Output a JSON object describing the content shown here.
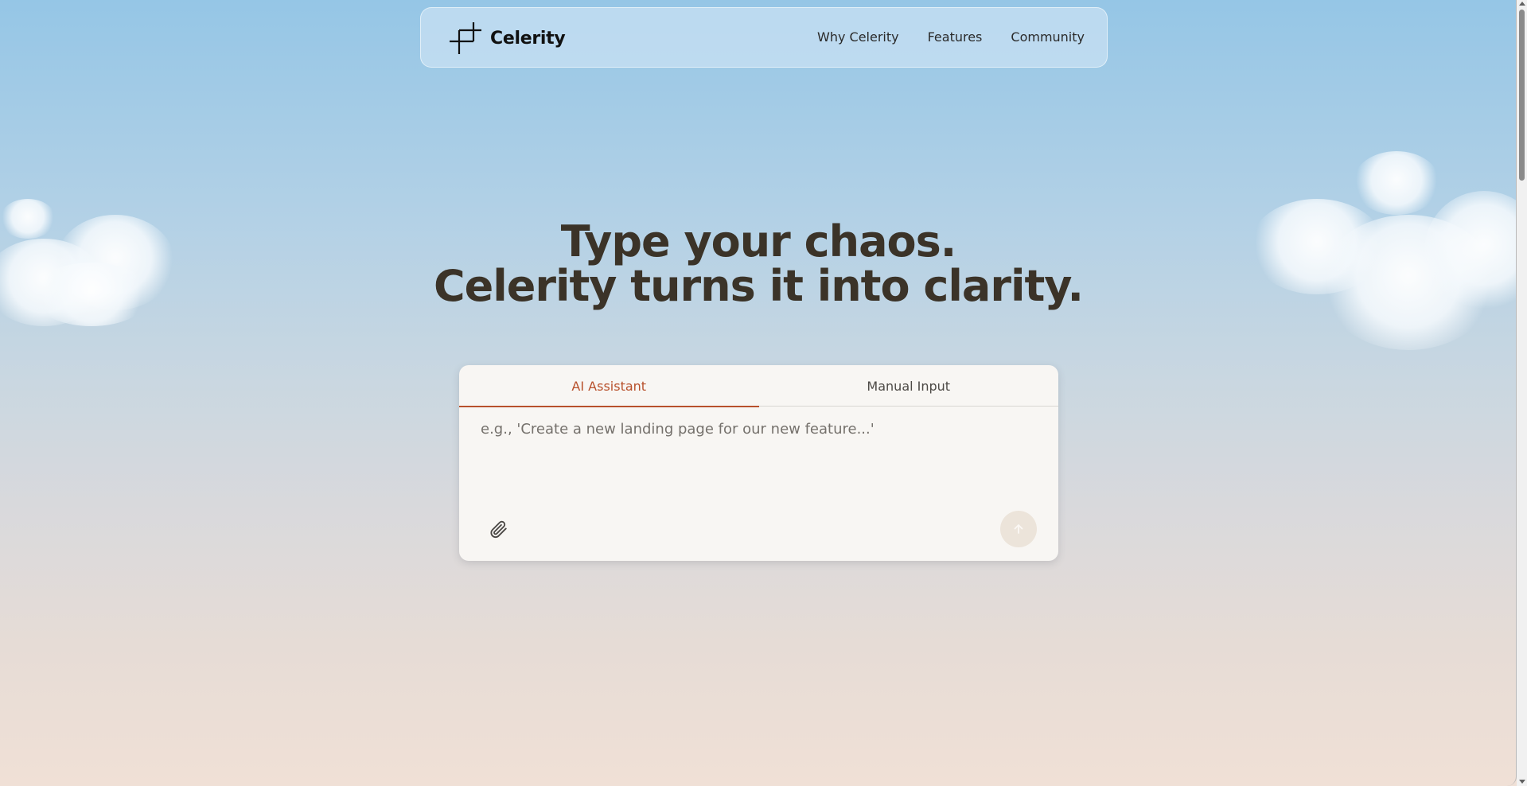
{
  "brand": {
    "name": "Celerity"
  },
  "nav": {
    "links": [
      "Why Celerity",
      "Features",
      "Community"
    ]
  },
  "hero": {
    "line1": "Type your chaos.",
    "line2": "Celerity turns it into clarity."
  },
  "composer": {
    "tabs": [
      "AI Assistant",
      "Manual Input"
    ],
    "active_tab": "AI Assistant",
    "placeholder": "e.g., 'Create a new landing page for our new feature...'",
    "value": "",
    "attach_icon": "paperclip-icon",
    "send_icon": "arrow-up-icon"
  },
  "colors": {
    "accent": "#b8512c",
    "headline": "#3b3328",
    "card_bg": "#f8f6f3"
  }
}
